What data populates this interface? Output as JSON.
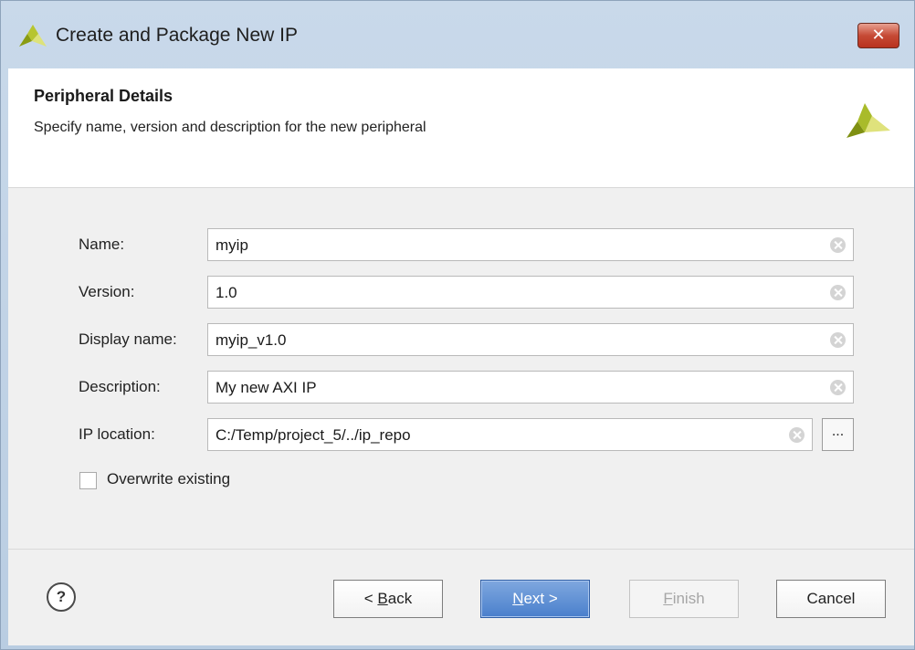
{
  "window": {
    "title": "Create and Package New IP",
    "close_glyph": "✕"
  },
  "header": {
    "title": "Peripheral Details",
    "subtitle": "Specify name, version and description for the new peripheral"
  },
  "form": {
    "fields": [
      {
        "label": "Name:",
        "value": "myip"
      },
      {
        "label": "Version:",
        "value": "1.0"
      },
      {
        "label": "Display name:",
        "value": "myip_v1.0"
      },
      {
        "label": "Description:",
        "value": "My new AXI IP"
      },
      {
        "label": "IP location:",
        "value": "C:/Temp/project_5/../ip_repo"
      }
    ],
    "browse_label": "...",
    "overwrite_label": "Overwrite existing",
    "overwrite_checked": false
  },
  "footer": {
    "help_label": "?",
    "back_label": "Back",
    "back_prefix": "< ",
    "back_mnemonic": "B",
    "back_rest": "ack",
    "next_mnemonic": "N",
    "next_rest": "ext >",
    "finish_mnemonic": "F",
    "finish_rest": "inish",
    "cancel_label": "Cancel"
  },
  "colors": {
    "accent": "#4a7fcc",
    "logo_dark": "#8a9c12",
    "logo_light": "#c8d23a"
  },
  "icons": [
    "xilinx-logo-icon",
    "close-icon",
    "clear-icon",
    "help-icon"
  ]
}
